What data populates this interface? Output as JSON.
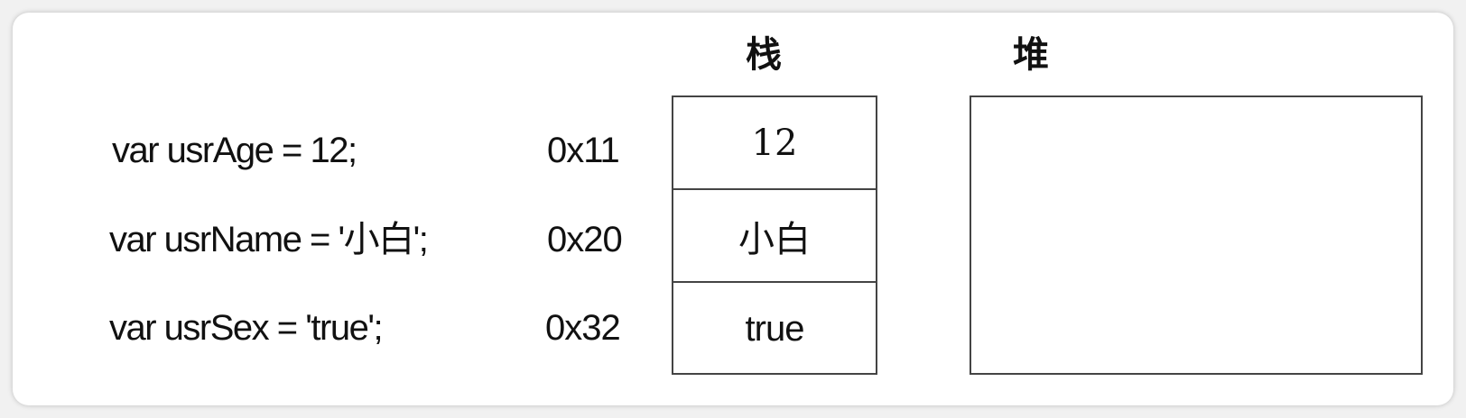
{
  "headers": {
    "stack": "栈",
    "heap": "堆"
  },
  "rows": [
    {
      "code": "var  usrAge = 12;",
      "address": "0x11",
      "value": "12"
    },
    {
      "code": "var  usrName = '小白';",
      "address": "0x20",
      "value": "小白"
    },
    {
      "code": "var  usrSex = 'true';",
      "address": "0x32",
      "value": "true"
    }
  ],
  "colors": {
    "border": "#444444",
    "text": "#111111",
    "background": "#ffffff"
  }
}
